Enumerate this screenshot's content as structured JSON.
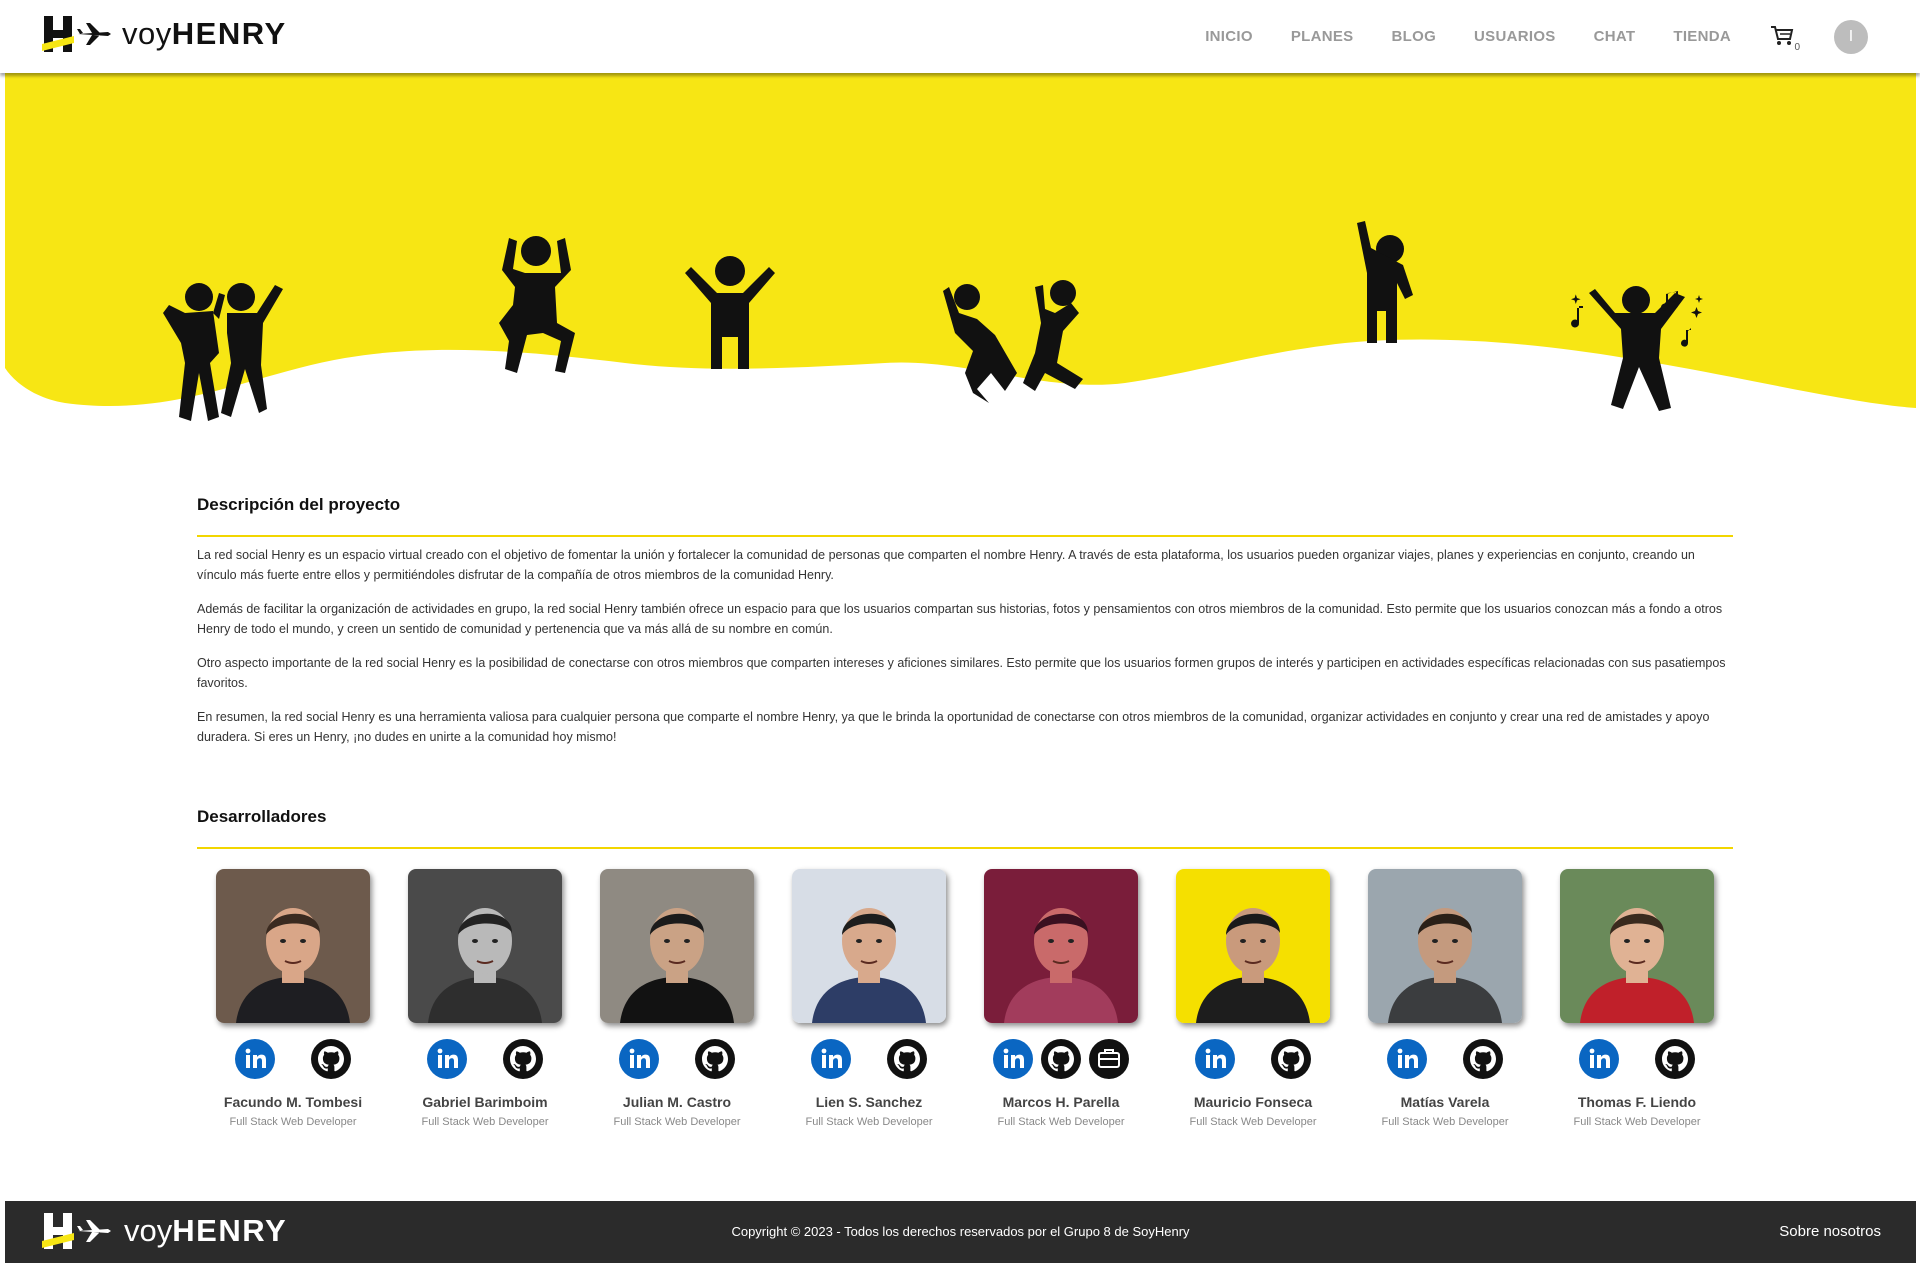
{
  "brand": {
    "prefix": "voy",
    "name": "HENRY"
  },
  "nav": {
    "items": [
      "INICIO",
      "PLANES",
      "BLOG",
      "USUARIOS",
      "CHAT",
      "TIENDA"
    ],
    "cart_count": "0",
    "avatar_initial": "I"
  },
  "colors": {
    "accent": "#f7e614",
    "rule": "#f2d600",
    "footer": "#2b2b2b"
  },
  "description": {
    "title": "Descripción del proyecto",
    "paragraphs": [
      "La red social Henry es un espacio virtual creado con el objetivo de fomentar la unión y fortalecer la comunidad de personas que comparten el nombre Henry. A través de esta plataforma, los usuarios pueden organizar viajes, planes y experiencias en conjunto, creando un vínculo más fuerte entre ellos y permitiéndoles disfrutar de la compañía de otros miembros de la comunidad Henry.",
      "Además de facilitar la organización de actividades en grupo, la red social Henry también ofrece un espacio para que los usuarios compartan sus historias, fotos y pensamientos con otros miembros de la comunidad. Esto permite que los usuarios conozcan más a fondo a otros Henry de todo el mundo, y creen un sentido de comunidad y pertenencia que va más allá de su nombre en común.",
      "Otro aspecto importante de la red social Henry es la posibilidad de conectarse con otros miembros que comparten intereses y aficiones similares. Esto permite que los usuarios formen grupos de interés y participen en actividades específicas relacionadas con sus pasatiempos favoritos.",
      "En resumen, la red social Henry es una herramienta valiosa para cualquier persona que comparte el nombre Henry, ya que le brinda la oportunidad de conectarse con otros miembros de la comunidad, organizar actividades en conjunto y crear una red de amistades y apoyo duradera. Si eres un Henry, ¡no dudes en unirte a la comunidad hoy mismo!"
    ]
  },
  "developers": {
    "title": "Desarrolladores",
    "list": [
      {
        "name": "Facundo M. Tombesi",
        "role": "Full Stack Web Developer",
        "bg": "#6d5a4c",
        "skin": "#d9a688",
        "hair": "#3a2a20",
        "shirt": "#1e1e22",
        "portfolio": false
      },
      {
        "name": "Gabriel Barimboim",
        "role": "Full Stack Web Developer",
        "bg": "#4a4a4a",
        "skin": "#b9b9b9",
        "hair": "#222222",
        "shirt": "#2e2e2e",
        "portfolio": false
      },
      {
        "name": "Julian M. Castro",
        "role": "Full Stack Web Developer",
        "bg": "#8f8a82",
        "skin": "#caa285",
        "hair": "#1b1b1b",
        "shirt": "#121212",
        "portfolio": false
      },
      {
        "name": "Lien S. Sanchez",
        "role": "Full Stack Web Developer",
        "bg": "#d7dde6",
        "skin": "#d8a98c",
        "hair": "#1d1d1d",
        "shirt": "#2d3d66",
        "portfolio": false
      },
      {
        "name": "Marcos H. Parella",
        "role": "Full Stack Web Developer",
        "bg": "#7a1d3a",
        "skin": "#c96a6a",
        "hair": "#3a1020",
        "shirt": "#a23c5c",
        "portfolio": true
      },
      {
        "name": "Mauricio Fonseca",
        "role": "Full Stack Web Developer",
        "bg": "#f5e000",
        "skin": "#c99a7c",
        "hair": "#1a1a1a",
        "shirt": "#1d1d1d",
        "portfolio": false
      },
      {
        "name": "Matías Varela",
        "role": "Full Stack Web Developer",
        "bg": "#9ba6ae",
        "skin": "#c49a7e",
        "hair": "#2a2018",
        "shirt": "#3b3d3f",
        "portfolio": false
      },
      {
        "name": "Thomas F. Liendo",
        "role": "Full Stack Web Developer",
        "bg": "#6a8a5a",
        "skin": "#e0b294",
        "hair": "#3a2a1e",
        "shirt": "#c0202a",
        "portfolio": false
      }
    ]
  },
  "footer": {
    "copyright": "Copyright © 2023 - Todos los derechos reservados por el Grupo 8 de SoyHenry",
    "about": "Sobre nosotros"
  }
}
